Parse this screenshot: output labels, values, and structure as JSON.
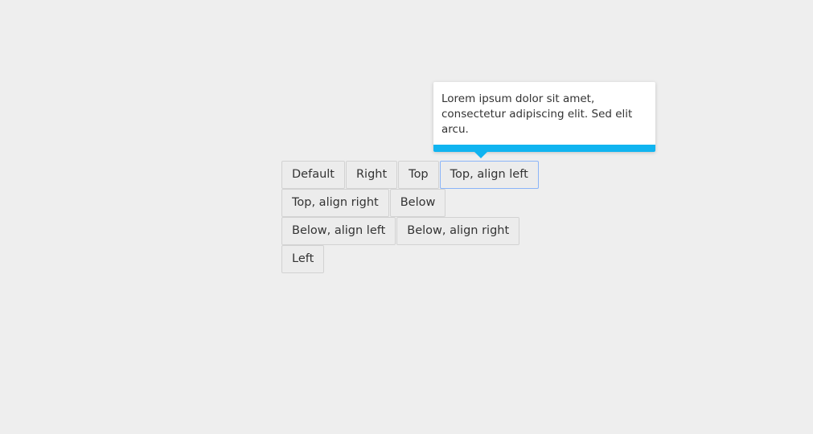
{
  "tooltip": {
    "text": "Lorem ipsum dolor sit amet, consectetur adipiscing elit. Sed elit arcu.",
    "accent_color": "#10b4f0"
  },
  "buttons": {
    "row1": [
      "Default",
      "Right",
      "Top",
      "Top, align left"
    ],
    "row2": [
      "Top, align right",
      "Below"
    ],
    "row3": [
      "Below, align left",
      "Below, align right"
    ],
    "row4": [
      "Left"
    ]
  },
  "focused_button": "Top, align left",
  "colors": {
    "background": "#eeeeee",
    "button_bg": "#ececec",
    "button_border": "#d2d2d2",
    "focus_border": "#8ab4f8"
  }
}
